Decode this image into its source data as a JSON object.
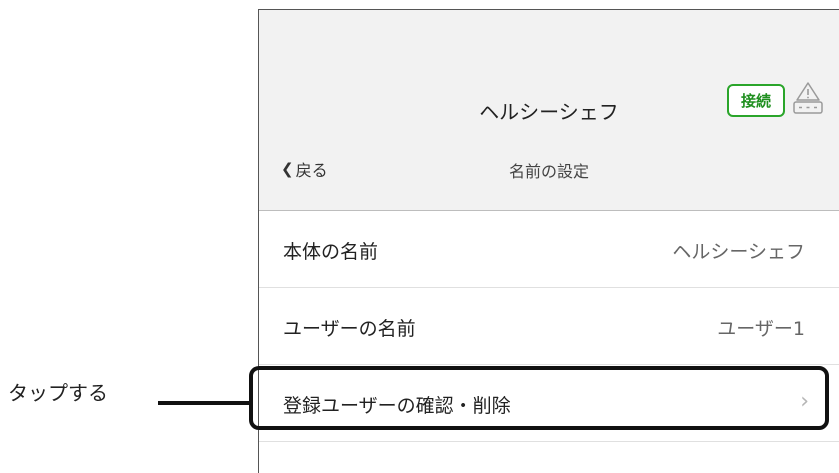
{
  "header": {
    "app_title": "ヘルシーシェフ",
    "connect_label": "接続",
    "back_label": "戻る",
    "page_title": "名前の設定"
  },
  "rows": [
    {
      "label": "本体の名前",
      "value": "ヘルシーシェフ"
    },
    {
      "label": "ユーザーの名前",
      "value": "ユーザー1"
    },
    {
      "label": "登録ユーザーの確認・削除",
      "value": ""
    }
  ],
  "callout": {
    "text": "タップする"
  },
  "colors": {
    "connect_border": "#2aa52a",
    "header_bg": "#f2f2f2"
  },
  "icons": {
    "back": "chevron-left-icon",
    "alert": "speaker-alert-icon",
    "row_arrow": "chevron-right-icon"
  }
}
